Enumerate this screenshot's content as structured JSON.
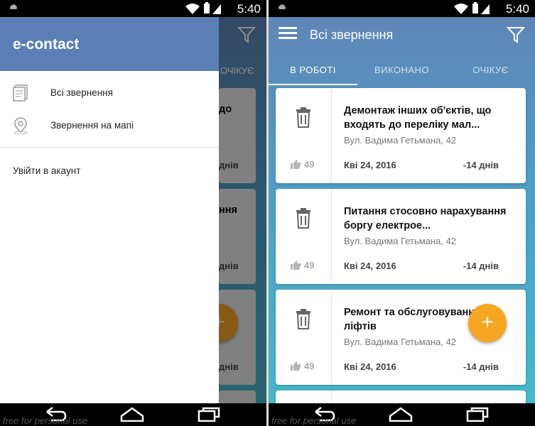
{
  "right": {
    "status": {
      "time": "5:40"
    },
    "toolbar": {
      "title": "Всі звернення"
    },
    "tabs": [
      "В РОБОТІ",
      "ВИКОНАНО",
      "ОЧІКУЄ"
    ],
    "cards": [
      {
        "title": "Демонтаж інших об'єктів, що входять до переліку мал...",
        "address": "Вул. Вадима Гетьмана, 42",
        "likes": "49",
        "date": "Кві 24, 2016",
        "days": "-14 днів"
      },
      {
        "title": "Питання стосовно нарахування боргу електрое...",
        "address": "Вул. Вадима Гетьмана, 42",
        "likes": "49",
        "date": "Кві 24, 2016",
        "days": "-14 днів"
      },
      {
        "title": "Ремонт та обслуговування ліфтів",
        "address": "Вул. Вадима Гетьмана, 42",
        "likes": "49",
        "date": "Кві 24, 2016",
        "days": "-14 днів"
      }
    ],
    "fab": "+",
    "watermark": "free for personal use"
  },
  "left": {
    "status": {
      "time": "5:40"
    },
    "drawer": {
      "brand": "e-contact",
      "items": [
        "Всі звернення",
        "Звернення на мапі"
      ],
      "login": "Увійти в акаунт"
    },
    "peek": {
      "tab": "ОЧІКУЄ",
      "text1": "до",
      "text2": "ння",
      "days": "днів",
      "fab": "+"
    },
    "watermark": "free for personal use"
  },
  "colors": {
    "accent": "#f5a623",
    "header": "#5b7fb5"
  }
}
